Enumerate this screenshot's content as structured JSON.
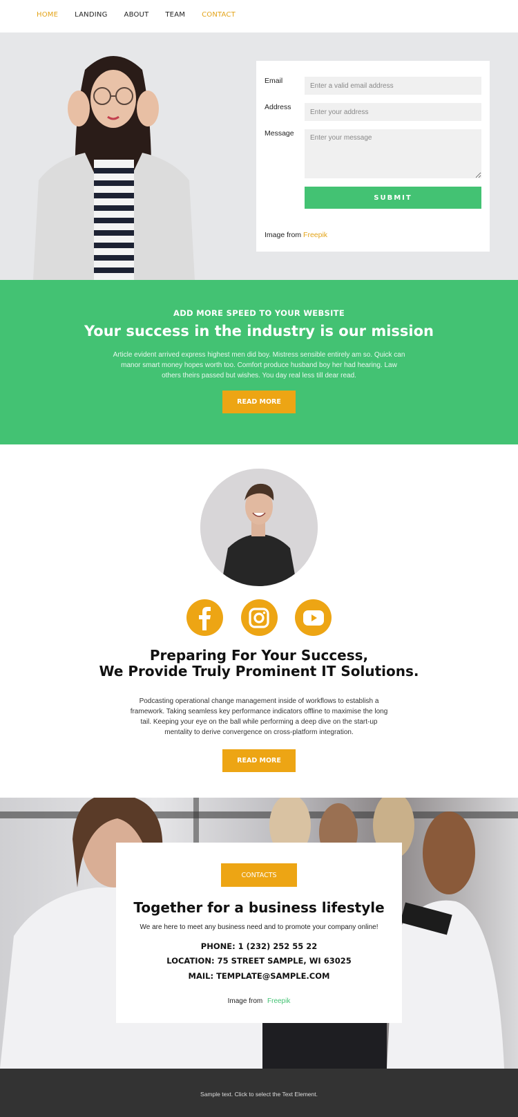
{
  "nav": {
    "items": [
      {
        "label": "HOME",
        "active": true
      },
      {
        "label": "LANDING",
        "active": false
      },
      {
        "label": "ABOUT",
        "active": false
      },
      {
        "label": "TEAM",
        "active": false
      },
      {
        "label": "CONTACT",
        "active": true
      }
    ]
  },
  "hero": {
    "form": {
      "email_label": "Email",
      "email_placeholder": "Enter a valid email address",
      "address_label": "Address",
      "address_placeholder": "Enter your address",
      "message_label": "Message",
      "message_placeholder": "Enter your message",
      "submit_label": "SUBMIT"
    },
    "credit_prefix": "Image from",
    "credit_link": "Freepik"
  },
  "mission": {
    "kicker": "ADD MORE SPEED TO YOUR WEBSITE",
    "title": "Your success in the industry is our mission",
    "body": "Article evident arrived express highest men did boy. Mistress sensible entirely am so. Quick can manor smart money hopes worth too. Comfort produce husband boy her had hearing. Law others theirs passed but wishes. You day real less till dear read.",
    "button": "READ MORE"
  },
  "profile": {
    "social": [
      "facebook",
      "instagram",
      "youtube"
    ],
    "title_line1": "Preparing For Your Success,",
    "title_line2": "We Provide Truly Prominent IT Solutions.",
    "body": "Podcasting operational change management inside of workflows to establish a framework. Taking seamless key performance indicators offline to maximise the long tail. Keeping your eye on the ball while performing a deep dive on the start-up mentality to derive convergence on cross-platform integration.",
    "button": "READ MORE"
  },
  "contact": {
    "button": "CONTACTS",
    "title": "Together for a business lifestyle",
    "lead": "We are here to meet any business need and to promote your company online!",
    "phone": "PHONE: 1 (232) 252 55 22",
    "location": "LOCATION: 75 STREET SAMPLE, WI 63025",
    "mail": "MAIL: TEMPLATE@SAMPLE.COM",
    "credit_prefix": "Image from",
    "credit_link": "Freepik"
  },
  "footer": {
    "text": "Sample text. Click to select the Text Element."
  },
  "colors": {
    "accent_orange": "#eda514",
    "accent_green": "#43c273",
    "nav_active": "#e3a317",
    "footer_bg": "#333333"
  }
}
